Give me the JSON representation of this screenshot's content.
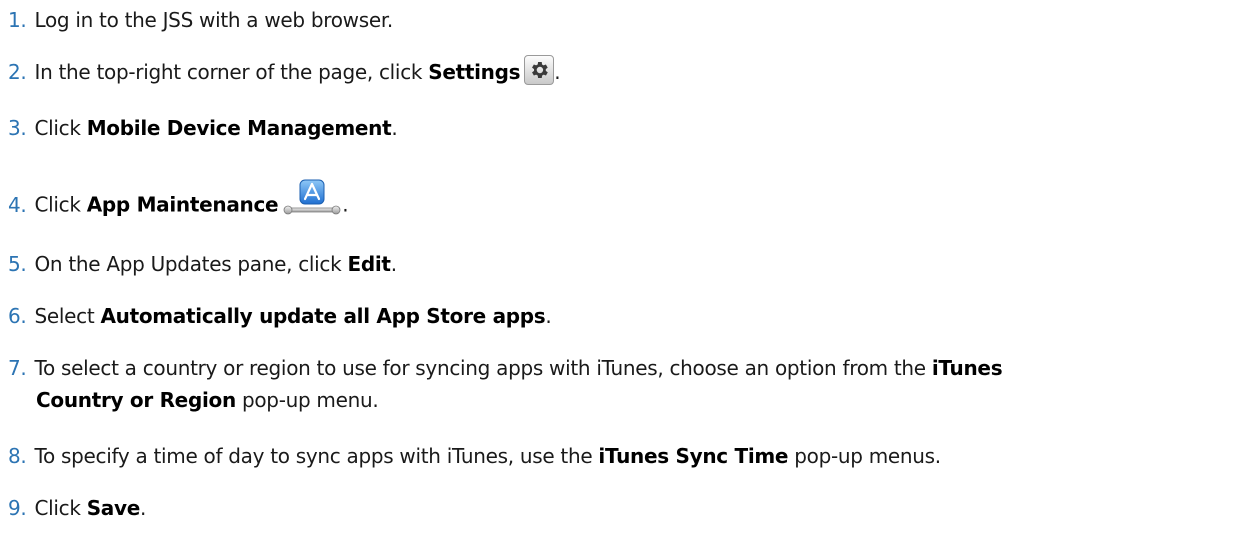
{
  "steps": [
    {
      "number": "1.",
      "text_a": "Log in to the JSS with a web browser."
    },
    {
      "number": "2.",
      "text_a": "In the top-right corner of the page, click ",
      "bold": "Settings",
      "after_icon": ".",
      "icon": "gear-icon"
    },
    {
      "number": "3.",
      "text_a": "Click ",
      "bold": "Mobile Device Management",
      "text_b": "."
    },
    {
      "number": "4.",
      "text_a": "Click ",
      "bold": "App Maintenance",
      "after_icon": ".",
      "icon": "app-store-wrench-icon"
    },
    {
      "number": "5.",
      "text_a": "On the App Updates pane, click ",
      "bold": "Edit",
      "text_b": "."
    },
    {
      "number": "6.",
      "text_a": "Select ",
      "bold": "Automatically update all App Store apps",
      "text_b": "."
    },
    {
      "number": "7.",
      "text_a": "To select a country or region to use for syncing apps with iTunes, choose an option from the ",
      "bold_line1": "iTunes",
      "bold_line2": "Country or Region",
      "text_b": " pop-up menu."
    },
    {
      "number": "8.",
      "text_a": "To specify a time of day to sync apps with iTunes, use the ",
      "bold": "iTunes Sync Time",
      "text_b": " pop-up menus."
    },
    {
      "number": "9.",
      "text_a": "Click ",
      "bold": "Save",
      "text_b": "."
    }
  ],
  "colors": {
    "step_number": "#2c74b3",
    "text": "#1a1a1a"
  }
}
